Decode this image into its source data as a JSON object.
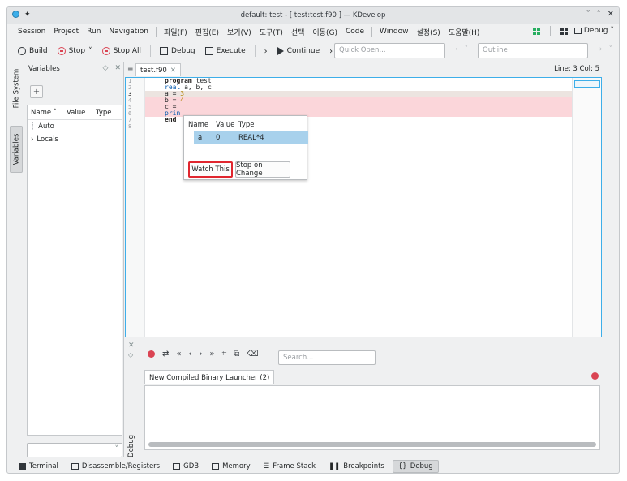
{
  "window": {
    "title": "default: test - [ test:test.f90 ] — KDevelop",
    "controls": [
      "˅",
      "˄",
      "✕"
    ]
  },
  "menubar": {
    "items": [
      "Session",
      "Project",
      "Run",
      "Navigation",
      "파일(F)",
      "편집(E)",
      "보기(V)",
      "도구(T)",
      "선택",
      "이동(G)",
      "Code",
      "Window",
      "설정(S)",
      "도움말(H)"
    ],
    "debug_area": "Debug"
  },
  "toolbar": {
    "build": "Build",
    "stop": "Stop",
    "stop_all": "Stop All",
    "debug": "Debug",
    "execute": "Execute",
    "continue": "Continue",
    "quick_open_placeholder": "Quick Open...",
    "outline_placeholder": "Outline"
  },
  "left_strip": {
    "file_system": "File System",
    "variables": "Variables"
  },
  "variables_panel": {
    "title": "Variables",
    "columns": [
      "Name",
      "Value",
      "Type"
    ],
    "rows": [
      "Auto",
      "Locals"
    ]
  },
  "editor": {
    "tab": "test.f90",
    "line_info": "Line: 3 Col: 5",
    "line_numbers": [
      "1",
      "2",
      "3",
      "4",
      "5",
      "6",
      "7",
      "8"
    ]
  },
  "popup": {
    "columns": [
      "Name",
      "Value",
      "Type"
    ],
    "row": {
      "name": "a",
      "value": "0",
      "type": "REAL*4"
    },
    "watch_button": "Watch This",
    "stop_button": "Stop on Change"
  },
  "bottom_panel": {
    "search_placeholder": "Search...",
    "launcher_tab": "New Compiled Binary Launcher (2)",
    "side_label": "Debug"
  },
  "statusbar": {
    "items": [
      "Terminal",
      "Disassemble/Registers",
      "GDB",
      "Memory",
      "Frame Stack",
      "Breakpoints",
      "Debug"
    ]
  },
  "colors": {
    "accent": "#3daee9",
    "breakpoint_line": "#fbd6da",
    "highlight_border": "#e0262f",
    "selection": "#a8d1ec"
  }
}
